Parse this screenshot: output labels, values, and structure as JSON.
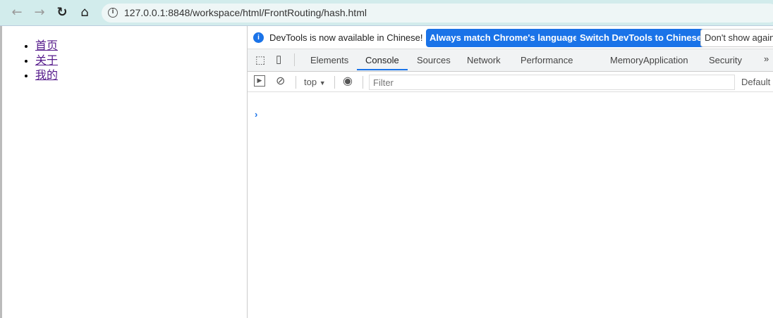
{
  "browser": {
    "url": "127.0.0.1:8848/workspace/html/FrontRouting/hash.html"
  },
  "page": {
    "links": [
      "首页",
      "关于",
      "我的"
    ]
  },
  "devtools": {
    "infobar": {
      "message": "DevTools is now available in Chinese!",
      "btn_match": "Always match Chrome's language",
      "btn_switch": "Switch DevTools to Chinese",
      "btn_dont": "Don't show again"
    },
    "tabs": [
      "Elements",
      "Console",
      "Sources",
      "Network",
      "Performance",
      "Memory",
      "Application",
      "Security"
    ],
    "active_tab": "Console",
    "more": "»",
    "toolbar": {
      "context": "top",
      "filter_placeholder": "Filter",
      "levels": "Default"
    },
    "prompt": "›"
  }
}
